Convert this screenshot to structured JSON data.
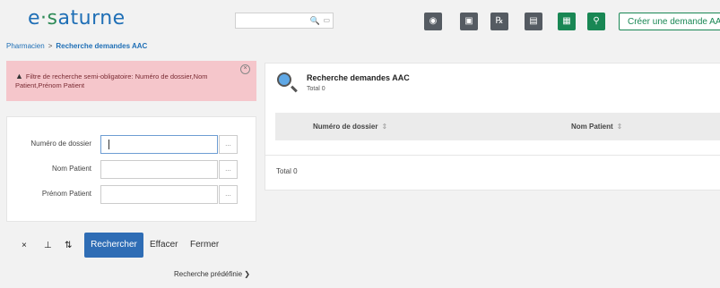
{
  "header": {
    "logo": {
      "prefix": "e",
      "dot": "·",
      "s": "s",
      "rest": "aturne"
    },
    "search": {
      "placeholder": ""
    },
    "create_button": "Créer une demande AAC",
    "toolbar_icons": [
      "binoculars-icon",
      "id-badge-icon",
      "prescription-icon",
      "document-icon",
      "id-card-icon",
      "search-icon"
    ]
  },
  "breadcrumb": {
    "parent": "Pharmacien",
    "separator": ">",
    "current": "Recherche demandes AAC"
  },
  "alert": {
    "text": "Filtre de recherche semi-obligatoire: Numéro de dossier,Nom Patient,Prénom Patient"
  },
  "form": {
    "fields": [
      {
        "label": "Numéro de dossier",
        "value": "",
        "button": "..."
      },
      {
        "label": "Nom Patient",
        "value": "",
        "button": "..."
      },
      {
        "label": "Prénom Patient",
        "value": "",
        "button": "..."
      }
    ],
    "actions": {
      "icons": [
        "×",
        "⊥",
        "⇅"
      ],
      "search": "Rechercher",
      "clear": "Effacer",
      "close": "Fermer"
    },
    "predefined": "Recherche prédéfinie"
  },
  "results": {
    "title": "Recherche demandes AAC",
    "total_top": "Total 0",
    "columns": [
      "Numéro de dossier",
      "Nom Patient"
    ],
    "total_bottom": "Total 0"
  },
  "colors": {
    "primary": "#2f6db5",
    "green": "#198754",
    "alert_bg": "#f5c6cb",
    "dark_button": "#555b62"
  }
}
